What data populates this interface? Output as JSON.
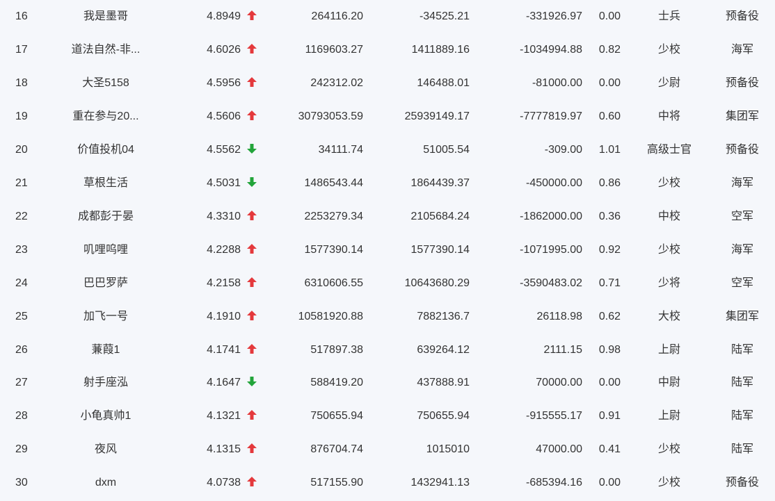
{
  "colors": {
    "background": "#f5f7fb",
    "text": "#333333",
    "up": "#e4393c",
    "down": "#22a43a"
  },
  "rows": [
    {
      "rank": "16",
      "name": "我是墨哥",
      "score": "4.8949",
      "trend": "up",
      "v1": "264116.20",
      "v2": "-34525.21",
      "v3": "-331926.97",
      "ratio": "0.00",
      "rank_title": "士兵",
      "army": "预备役"
    },
    {
      "rank": "17",
      "name": "道法自然-非...",
      "score": "4.6026",
      "trend": "up",
      "v1": "1169603.27",
      "v2": "1411889.16",
      "v3": "-1034994.88",
      "ratio": "0.82",
      "rank_title": "少校",
      "army": "海军"
    },
    {
      "rank": "18",
      "name": "大圣5158",
      "score": "4.5956",
      "trend": "up",
      "v1": "242312.02",
      "v2": "146488.01",
      "v3": "-81000.00",
      "ratio": "0.00",
      "rank_title": "少尉",
      "army": "预备役"
    },
    {
      "rank": "19",
      "name": "重在参与20...",
      "score": "4.5606",
      "trend": "up",
      "v1": "30793053.59",
      "v2": "25939149.17",
      "v3": "-7777819.97",
      "ratio": "0.60",
      "rank_title": "中将",
      "army": "集团军"
    },
    {
      "rank": "20",
      "name": "价值投机04",
      "score": "4.5562",
      "trend": "down",
      "v1": "34111.74",
      "v2": "51005.54",
      "v3": "-309.00",
      "ratio": "1.01",
      "rank_title": "高级士官",
      "army": "预备役"
    },
    {
      "rank": "21",
      "name": "草根生活",
      "score": "4.5031",
      "trend": "down",
      "v1": "1486543.44",
      "v2": "1864439.37",
      "v3": "-450000.00",
      "ratio": "0.86",
      "rank_title": "少校",
      "army": "海军"
    },
    {
      "rank": "22",
      "name": "成都彭于晏",
      "score": "4.3310",
      "trend": "up",
      "v1": "2253279.34",
      "v2": "2105684.24",
      "v3": "-1862000.00",
      "ratio": "0.36",
      "rank_title": "中校",
      "army": "空军"
    },
    {
      "rank": "23",
      "name": "叽哩呜哩",
      "score": "4.2288",
      "trend": "up",
      "v1": "1577390.14",
      "v2": "1577390.14",
      "v3": "-1071995.00",
      "ratio": "0.92",
      "rank_title": "少校",
      "army": "海军"
    },
    {
      "rank": "24",
      "name": "巴巴罗萨",
      "score": "4.2158",
      "trend": "up",
      "v1": "6310606.55",
      "v2": "10643680.29",
      "v3": "-3590483.02",
      "ratio": "0.71",
      "rank_title": "少将",
      "army": "空军"
    },
    {
      "rank": "25",
      "name": "加飞一号",
      "score": "4.1910",
      "trend": "up",
      "v1": "10581920.88",
      "v2": "7882136.7",
      "v3": "26118.98",
      "ratio": "0.62",
      "rank_title": "大校",
      "army": "集团军"
    },
    {
      "rank": "26",
      "name": "蒹葭1",
      "score": "4.1741",
      "trend": "up",
      "v1": "517897.38",
      "v2": "639264.12",
      "v3": "2111.15",
      "ratio": "0.98",
      "rank_title": "上尉",
      "army": "陆军"
    },
    {
      "rank": "27",
      "name": "射手座泓",
      "score": "4.1647",
      "trend": "down",
      "v1": "588419.20",
      "v2": "437888.91",
      "v3": "70000.00",
      "ratio": "0.00",
      "rank_title": "中尉",
      "army": "陆军"
    },
    {
      "rank": "28",
      "name": "小龟真帅1",
      "score": "4.1321",
      "trend": "up",
      "v1": "750655.94",
      "v2": "750655.94",
      "v3": "-915555.17",
      "ratio": "0.91",
      "rank_title": "上尉",
      "army": "陆军"
    },
    {
      "rank": "29",
      "name": "夜风",
      "score": "4.1315",
      "trend": "up",
      "v1": "876704.74",
      "v2": "1015010",
      "v3": "47000.00",
      "ratio": "0.41",
      "rank_title": "少校",
      "army": "陆军"
    },
    {
      "rank": "30",
      "name": "dxm",
      "score": "4.0738",
      "trend": "up",
      "v1": "517155.90",
      "v2": "1432941.13",
      "v3": "-685394.16",
      "ratio": "0.00",
      "rank_title": "少校",
      "army": "预备役"
    }
  ]
}
